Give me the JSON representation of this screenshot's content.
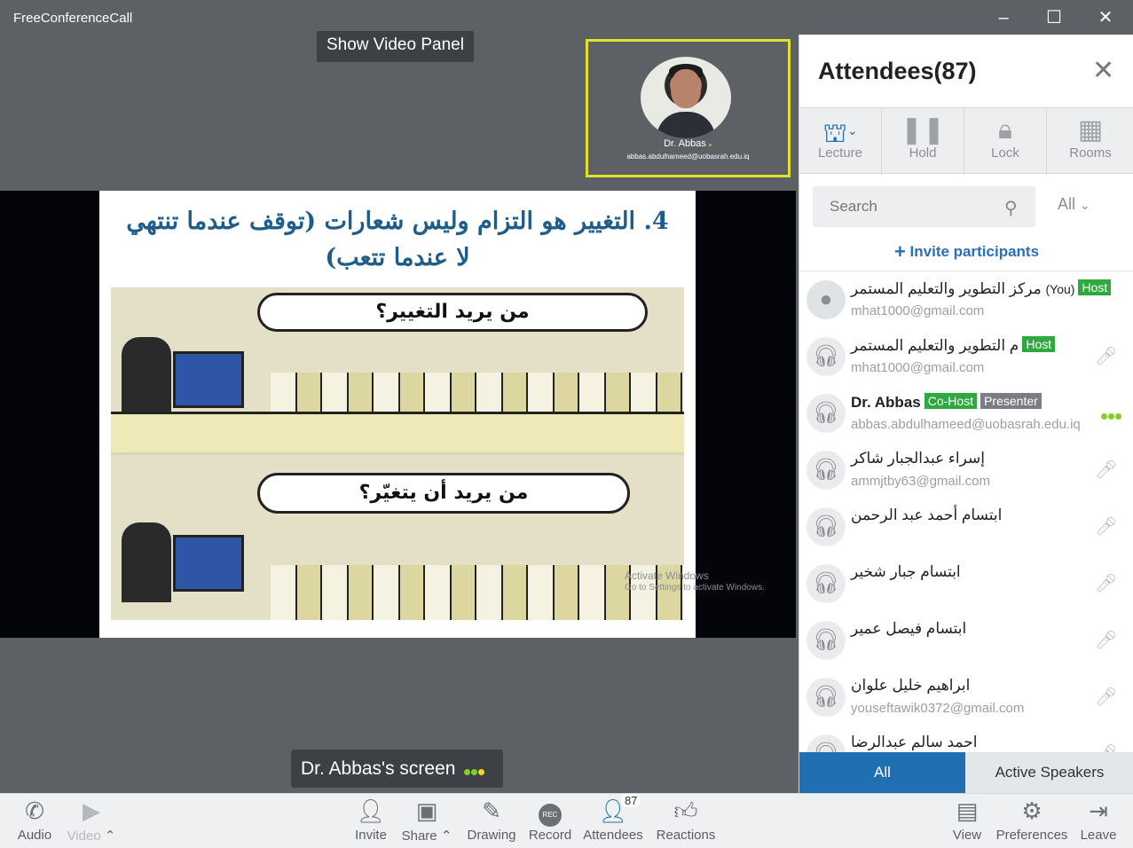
{
  "window": {
    "title": "FreeConferenceCall",
    "minimize": "–",
    "maximize": "☐",
    "close": "✕"
  },
  "stage": {
    "show_video_panel": "Show Video Panel",
    "video_tile": {
      "name": "Dr. Abbas",
      "email": "abbas.abdulhameed@uobasrah.edu.iq"
    },
    "slide": {
      "title": "4. التغيير هو التزام وليس شعارات (توقف عندما تنتهي لا عندما تتعب)",
      "bubble_top": "من يريد التغيير؟",
      "bubble_bottom": "من يريد أن يتغيّر؟"
    },
    "watermark": {
      "line1": "Activate Windows",
      "line2": "Go to Settings to activate Windows."
    },
    "screen_label": "Dr. Abbas's screen",
    "colors": {
      "tile_border": "#e1e02c",
      "dot_green": "#7ed321",
      "dot_yellow": "#f5d130"
    }
  },
  "toolbar": {
    "audio": "Audio",
    "video": "Video",
    "invite": "Invite",
    "share": "Share",
    "drawing": "Drawing",
    "record": "Record",
    "record_badge": "REC",
    "attendees": "Attendees",
    "attendees_count": "87",
    "reactions": "Reactions",
    "view": "View",
    "preferences": "Preferences",
    "leave": "Leave"
  },
  "sidebar": {
    "title": "Attendees(87)",
    "close": "✕",
    "tools": {
      "lecture": "Lecture",
      "hold": "Hold",
      "lock": "Lock",
      "rooms": "Rooms"
    },
    "search_placeholder": "Search",
    "filter": "All",
    "invite_participants": "Invite participants",
    "attendees": [
      {
        "name": "مركز التطوير والتعليم المستمر",
        "you": "(You)",
        "tag1": "Host",
        "email": "mhat1000@gmail.com"
      },
      {
        "name": "م      التطوير والتعليم المستمر",
        "tag1": "Host",
        "email": "mhat1000@gmail.com"
      },
      {
        "name": "Dr. Abbas",
        "tag1": "Co-Host",
        "tag2": "Presenter",
        "email": "abbas.abdulhameed@uobasrah.edu.iq"
      },
      {
        "name": "إسراء عبدالجبار شاكر",
        "email": "ammjtby63@gmail.com"
      },
      {
        "name": "ابتسام أحمد عبد الرحمن",
        "email": ""
      },
      {
        "name": "ابتسام جبار شخير",
        "email": ""
      },
      {
        "name": "ابتسام فيصل عمير",
        "email": ""
      },
      {
        "name": "ابراهيم خليل علوان",
        "email": "youseftawik0372@gmail.com"
      },
      {
        "name": "احمد سالم عبدالرضا",
        "email": ""
      }
    ],
    "tab_all": "All",
    "tab_active_speakers": "Active Speakers",
    "colors": {
      "accent": "#1f6fb2",
      "host_tag": "#2ea83f",
      "presenter_tag": "#7a7e83"
    }
  }
}
